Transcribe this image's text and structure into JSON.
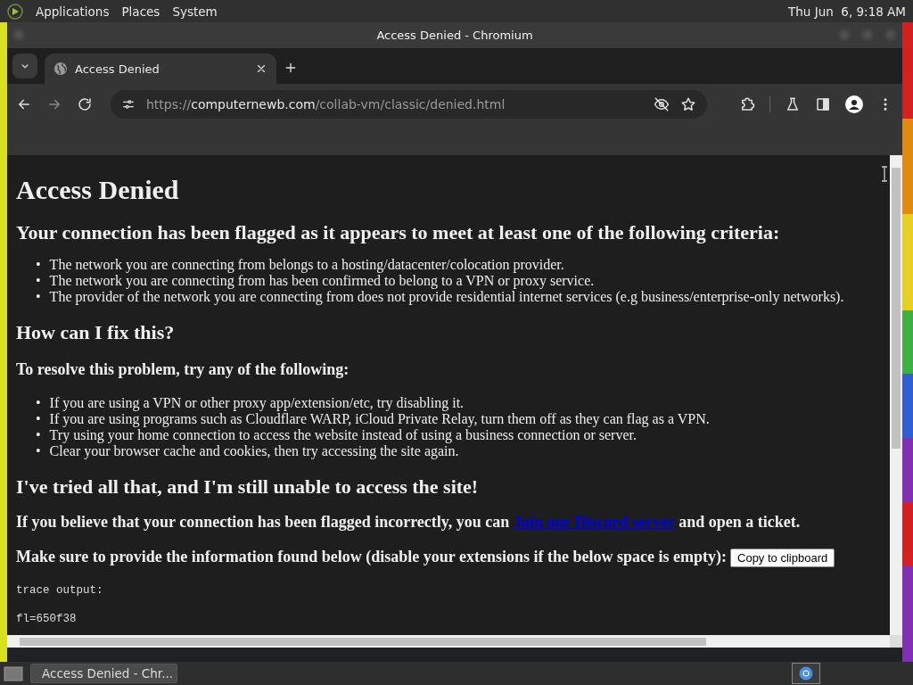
{
  "top_panel": {
    "menus": [
      "Applications",
      "Places",
      "System"
    ],
    "clock": "Thu Jun  6, 9:18 AM"
  },
  "window": {
    "title": "Access Denied - Chromium"
  },
  "tabs": [
    {
      "label": "Access Denied",
      "selected": true
    }
  ],
  "address_bar": {
    "scheme": "https://",
    "host": "computernewb.com",
    "path": "/collab-vm/classic/denied.html"
  },
  "page": [
    {
      "kind": "h1",
      "text": "Access Denied"
    },
    {
      "kind": "h2",
      "text": "Your connection has been flagged as it appears to meet at least one of the following criteria:"
    },
    {
      "kind": "list",
      "items": [
        {
          "bullet": "•",
          "text": "The network you are connecting from belongs to a hosting/datacenter/colocation provider."
        },
        {
          "bullet": "•",
          "text": "The network you are connecting from has been confirmed to belong to a VPN or proxy service."
        },
        {
          "bullet": "•",
          "text": "The provider of the network you are connecting from does not provide residential internet services (e.g business/enterprise-only networks)."
        }
      ]
    },
    {
      "kind": "h2",
      "text": "How can I fix this?"
    },
    {
      "kind": "h3",
      "text": "To resolve this problem, try any of the following:"
    },
    {
      "kind": "list",
      "items": [
        {
          "bullet": "•",
          "text": "If you are using a VPN or other proxy app/extension/etc, try disabling it."
        },
        {
          "bullet": "•",
          "text": "If you are using programs such as Cloudflare WARP, iCloud Private Relay, turn them off as they can flag as a VPN."
        },
        {
          "bullet": "•",
          "text": "Try using your home connection to access the website instead of using a business connection or server."
        },
        {
          "bullet": "•",
          "text": "Clear your browser cache and cookies, then try accessing the site again."
        }
      ]
    },
    {
      "kind": "h2",
      "text": "I've tried all that, and I'm still unable to access the site!"
    },
    {
      "kind": "link_para",
      "before": "If you believe that your connection has been flagged incorrectly, you can",
      "link": "Join our Discord server",
      "after": "and open a ticket."
    },
    {
      "kind": "button_para",
      "text": "Make sure to provide the information found below (disable your extensions if the below space is empty):",
      "button": "Copy to clipboard"
    },
    {
      "kind": "pre",
      "lines": [
        "trace output:",
        "fl=650f38"
      ]
    }
  ],
  "taskbar": {
    "items": [
      {
        "label": "Access Denied - Chr...",
        "selected": true
      }
    ]
  }
}
